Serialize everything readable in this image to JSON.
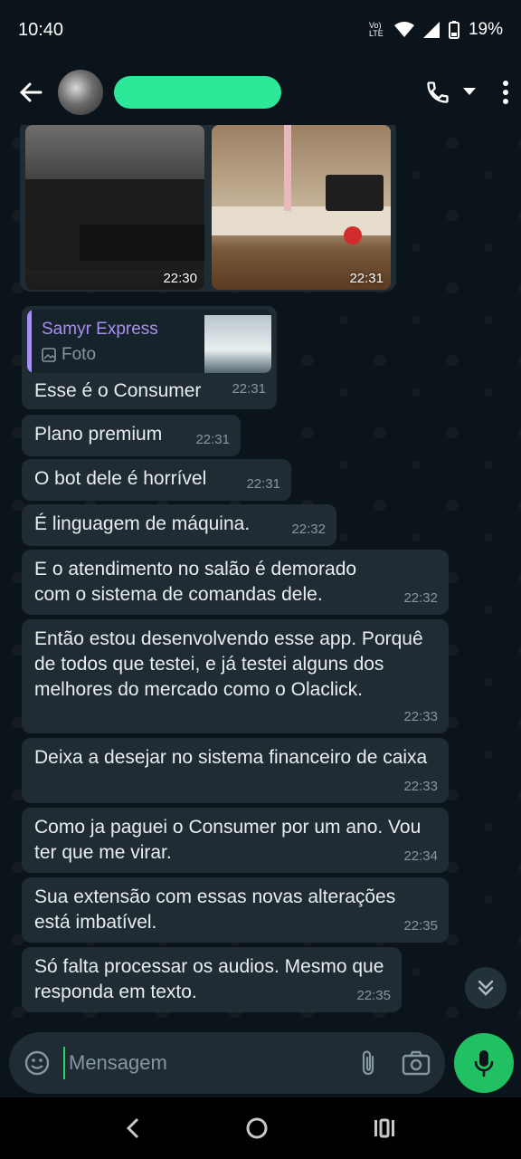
{
  "status_bar": {
    "time": "10:40",
    "network": "Vo) LTE",
    "battery": "19%"
  },
  "header": {
    "icons": [
      "back-arrow-icon",
      "call-icon",
      "dropdown-icon",
      "more-vert-icon"
    ]
  },
  "media": {
    "photos": [
      {
        "time": "22:30"
      },
      {
        "time": "22:31"
      }
    ]
  },
  "quoted": {
    "author": "Samyr Express",
    "type": "Foto"
  },
  "messages": [
    {
      "text": "Esse é o Consumer",
      "time": "22:31"
    },
    {
      "text": "Plano premium",
      "time": "22:31"
    },
    {
      "text": "O bot dele é horrível",
      "time": "22:31"
    },
    {
      "text": "É linguagem de máquina.",
      "time": "22:32"
    },
    {
      "text": "E o atendimento no salão é  demorado com o sistema de comandas dele.",
      "time": "22:32"
    },
    {
      "text": "Então estou desenvolvendo esse app. Porquê de todos que testei, e já testei alguns dos melhores do mercado como o Olaclick.",
      "time": "22:33"
    },
    {
      "text": "Deixa a desejar no sistema financeiro de caixa",
      "time": "22:33"
    },
    {
      "text": "Como ja paguei o Consumer por um ano. Vou ter que me virar.",
      "time": "22:34"
    },
    {
      "text": "Sua extensão com essas novas alterações está imbatível.",
      "time": "22:35"
    },
    {
      "text": "Só falta processar os audios. Mesmo que responda em texto.",
      "time": "22:35"
    }
  ],
  "composer": {
    "placeholder": "Mensagem"
  },
  "colors": {
    "accent": "#21c063",
    "bubble": "#1f2c34",
    "background": "#0b141a",
    "quote_bar": "#a88ff3"
  }
}
